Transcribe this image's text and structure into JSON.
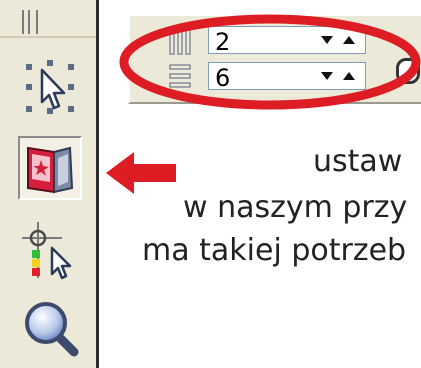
{
  "toolbar": {
    "tools": [
      {
        "name": "pick-tool-icon",
        "pressed": false
      },
      {
        "name": "interactive-tool-icon",
        "pressed": true
      },
      {
        "name": "guide-transform-tool-icon",
        "pressed": false
      },
      {
        "name": "zoom-tool-icon",
        "pressed": false
      }
    ]
  },
  "property_bar": {
    "columns_value": "2",
    "rows_value": "6",
    "columns_icon": "columns-icon",
    "rows_icon": "rows-icon"
  },
  "annotation": {
    "highlight_color": "#dd1c24",
    "arrow_color": "#dd1c24"
  },
  "caption": {
    "line1": "ustaw",
    "line2": "w naszym przy",
    "line3": "ma takiej potrzeb"
  }
}
